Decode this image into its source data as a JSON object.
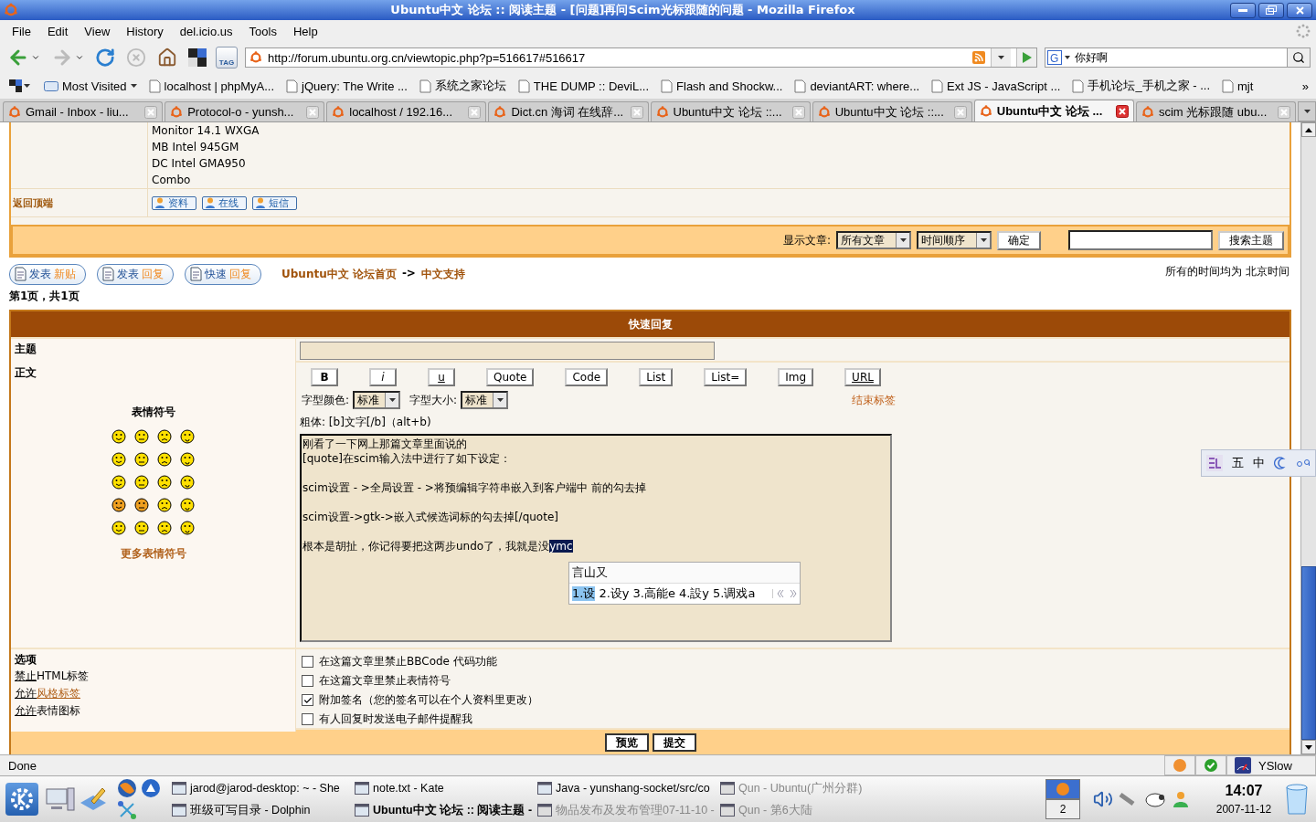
{
  "window": {
    "title": "Ubuntu中文 论坛 :: 阅读主题 - [问题]再问Scim光标跟随的问题 - Mozilla Firefox"
  },
  "menu": [
    "File",
    "Edit",
    "View",
    "History",
    "del.icio.us",
    "Tools",
    "Help"
  ],
  "toolbar": {
    "url": "http://forum.ubuntu.org.cn/viewtopic.php?p=516617#516617",
    "search_value": "你好啊",
    "engine": "G",
    "tag": "TAG"
  },
  "bookmarks": [
    {
      "label": "Most Visited",
      "kind": "folder"
    },
    {
      "label": "localhost | phpMyA...",
      "kind": "link"
    },
    {
      "label": "jQuery: The Write ...",
      "kind": "link"
    },
    {
      "label": "系统之家论坛",
      "kind": "link"
    },
    {
      "label": "THE DUMP :: DeviL...",
      "kind": "link"
    },
    {
      "label": "Flash and Shockw...",
      "kind": "link"
    },
    {
      "label": "deviantART: where...",
      "kind": "link"
    },
    {
      "label": "Ext JS - JavaScript ...",
      "kind": "link"
    },
    {
      "label": "手机论坛_手机之家 - ...",
      "kind": "link"
    },
    {
      "label": "mjt",
      "kind": "link"
    }
  ],
  "bookmarks_more": "»",
  "tabs": [
    {
      "label": "Gmail - Inbox - liu...",
      "selected": false
    },
    {
      "label": "Protocol-o - yunsh...",
      "selected": false
    },
    {
      "label": "localhost / 192.16...",
      "selected": false
    },
    {
      "label": "Dict.cn 海词 在线辞...",
      "selected": false
    },
    {
      "label": "Ubuntu中文 论坛 ::...",
      "selected": false
    },
    {
      "label": "Ubuntu中文 论坛 ::...",
      "selected": false
    },
    {
      "label": "Ubuntu中文 论坛 ...",
      "selected": true
    },
    {
      "label": "scim 光标跟随 ubu...",
      "selected": false
    }
  ],
  "post": {
    "lines": [
      "Monitor 14.1 WXGA",
      "MB Intel 945GM",
      "DC Intel GMA950",
      "Combo"
    ],
    "back_to_top": "返回顶端",
    "profile_buttons": [
      "资料",
      "在线",
      "短信"
    ]
  },
  "filter_bar": {
    "label": "显示文章:",
    "range": "所有文章",
    "order": "时间顺序",
    "ok": "确定",
    "search_button": "搜索主题"
  },
  "actions": [
    {
      "main": "发表",
      "accent": "新贴"
    },
    {
      "main": "发表",
      "accent": "回复"
    },
    {
      "main": "快速",
      "accent": "回复"
    }
  ],
  "breadcrumb": {
    "home": "Ubuntu中文 论坛首页",
    "separator": "->",
    "forum": "中文支持"
  },
  "timezone": "所有的时间均为 北京时间",
  "pagination": "第1页，共1页",
  "quick_reply": {
    "title": "快速回复",
    "subject_label": "主题",
    "body_label": "正文",
    "smilies_title": "表情符号",
    "more_smilies": "更多表情符号",
    "bbcode_buttons": [
      {
        "label": "B",
        "kind": "bold"
      },
      {
        "label": "i",
        "kind": "italic"
      },
      {
        "label": "u",
        "kind": "underline"
      },
      {
        "label": "Quote",
        "kind": "plain"
      },
      {
        "label": "Code",
        "kind": "plain"
      },
      {
        "label": "List",
        "kind": "plain"
      },
      {
        "label": "List=",
        "kind": "plain"
      },
      {
        "label": "Img",
        "kind": "plain"
      },
      {
        "label": "URL",
        "kind": "underline"
      }
    ],
    "color_label": "字型颜色:",
    "color_value": "标准",
    "size_label": "字型大小:",
    "size_value": "标准",
    "close_tags": "结束标签",
    "hint": "粗体: [b]文字[/b]（alt+b)",
    "body_paragraphs": [
      [
        "刚看了一下网上那篇文章里面说的",
        "[quote]在scim输入法中进行了如下设定："
      ],
      [
        "scim设置 - >全局设置 - >将预编辑字符串嵌入到客户端中 前的勾去掉"
      ],
      [
        "scim设置->gtk->嵌入式候选词标的勾去掉[/quote]"
      ],
      [
        "根本是胡扯，你记得要把这两步undo了，我就是没"
      ]
    ],
    "preedit": "ymc",
    "ime": {
      "preedit": "言山又",
      "candidates": [
        {
          "label": "1.设",
          "selected": true
        },
        {
          "label": "2.设y",
          "selected": false
        },
        {
          "label": "3.高能e",
          "selected": false
        },
        {
          "label": "4.設y",
          "selected": false
        },
        {
          "label": "5.调戏a",
          "selected": false
        }
      ]
    },
    "options_label": "选项",
    "option_notes": [
      {
        "head": "禁止",
        "tail": "HTML标签",
        "tail_link": false
      },
      {
        "head": "允许",
        "tail": "风格标签",
        "tail_link": true
      },
      {
        "head": "允许",
        "tail": "表情图标",
        "tail_link": false
      }
    ],
    "options": [
      {
        "label": "在这篇文章里禁止BBCode 代码功能",
        "checked": false
      },
      {
        "label": "在这篇文章里禁止表情符号",
        "checked": false
      },
      {
        "label": "附加签名（您的签名可以在个人资料里更改）",
        "checked": true
      },
      {
        "label": "有人回复时发送电子邮件提醒我",
        "checked": false
      }
    ],
    "buttons": [
      "预览",
      "提交"
    ]
  },
  "ime_toolbar": {
    "method": "五",
    "language": "中"
  },
  "status": {
    "text": "Done",
    "yslow": "YSlow"
  },
  "taskbar": {
    "tasks": [
      {
        "label": "jarod@jarod-desktop: ~ - She",
        "active": false,
        "minimized": false
      },
      {
        "label": "note.txt - Kate",
        "active": false,
        "minimized": false
      },
      {
        "label": "Java - yunshang-socket/src/co",
        "active": false,
        "minimized": false
      },
      {
        "label": "Qun - Ubuntu(广州分群)",
        "active": false,
        "minimized": true
      },
      {
        "label": "班级可写目录 - Dolphin",
        "active": false,
        "minimized": false
      },
      {
        "label": "Ubuntu中文 论坛 :: 阅读主题 -",
        "active": true,
        "minimized": false
      },
      {
        "label": "物品发布及发布管理07-11-10 -",
        "active": false,
        "minimized": true
      },
      {
        "label": "Qun - 第6大陆",
        "active": false,
        "minimized": true
      }
    ],
    "pager": [
      {
        "selected": true
      },
      {
        "label": "2",
        "selected": false
      }
    ],
    "time": "14:07",
    "date": "2007-11-12"
  }
}
